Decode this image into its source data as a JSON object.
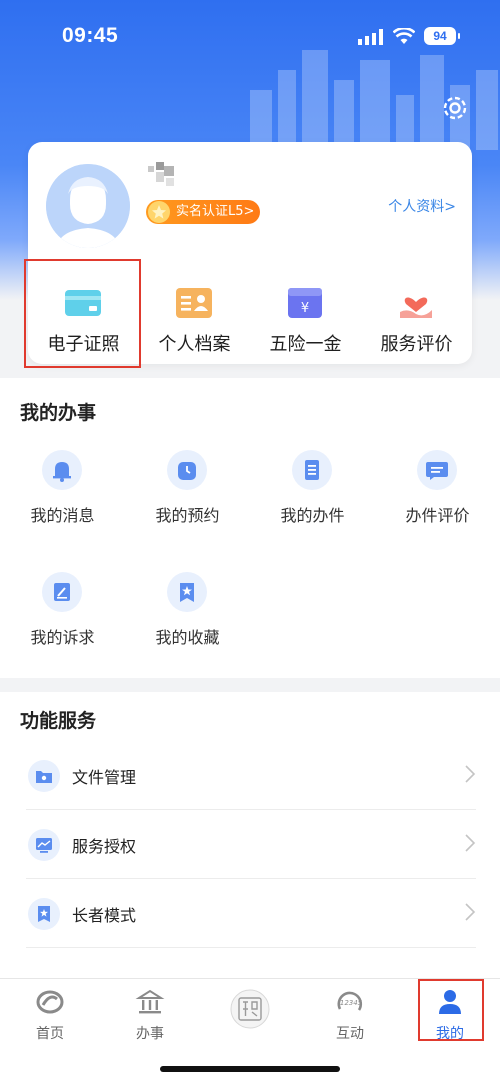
{
  "status_bar": {
    "time": "09:45",
    "battery": "94"
  },
  "profile": {
    "badge": "实名认证L5>",
    "link": "个人资料>"
  },
  "quick_actions": [
    {
      "label": "电子证照",
      "icon": "card-icon"
    },
    {
      "label": "个人档案",
      "icon": "profile-file-icon"
    },
    {
      "label": "五险一金",
      "icon": "yen-icon"
    },
    {
      "label": "服务评价",
      "icon": "heart-hand-icon"
    }
  ],
  "my_affairs": {
    "title": "我的办事",
    "items": [
      {
        "label": "我的消息",
        "icon": "bell-icon"
      },
      {
        "label": "我的预约",
        "icon": "alarm-icon"
      },
      {
        "label": "我的办件",
        "icon": "document-icon"
      },
      {
        "label": "办件评价",
        "icon": "comment-icon"
      },
      {
        "label": "我的诉求",
        "icon": "edit-icon"
      },
      {
        "label": "我的收藏",
        "icon": "bookmark-icon"
      }
    ]
  },
  "functions": {
    "title": "功能服务",
    "items": [
      {
        "label": "文件管理",
        "icon": "folder-icon"
      },
      {
        "label": "服务授权",
        "icon": "monitor-icon"
      },
      {
        "label": "长者模式",
        "icon": "star-bookmark-icon"
      }
    ]
  },
  "tabbar": [
    {
      "label": "首页",
      "icon": "home-logo-icon",
      "active": false
    },
    {
      "label": "办事",
      "icon": "building-icon",
      "active": false
    },
    {
      "label": "",
      "icon": "seal-icon",
      "active": false
    },
    {
      "label": "互动",
      "icon": "hotline-12345-icon",
      "active": false
    },
    {
      "label": "我的",
      "icon": "user-icon",
      "active": true
    }
  ],
  "tab_seal_text": "12345",
  "colors": {
    "primary": "#2f6ff0",
    "badge": "#ff8a1a",
    "highlight": "#e03a2e"
  }
}
